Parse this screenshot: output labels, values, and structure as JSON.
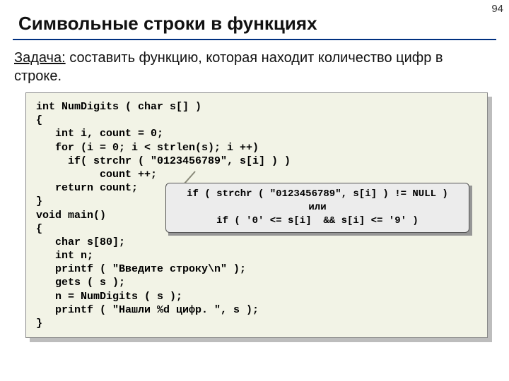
{
  "page_number": "94",
  "title": "Символьные строки в функциях",
  "task_label": "Задача:",
  "task_text": " составить функцию, которая находит количество цифр в строке.",
  "code": "int NumDigits ( char s[] )\n{\n   int i, count = 0;\n   for (i = 0; i < strlen(s); i ++)\n     if( strchr ( \"0123456789\", s[i] ) )\n          count ++;\n   return count;\n}\nvoid main()\n{\n   char s[80];\n   int n;\n   printf ( \"Введите строку\\n\" );\n   gets ( s );\n   n = NumDigits ( s );\n   printf ( \"Нашли %d цифр. \", s );\n}",
  "inset_line1": "if ( strchr ( \"0123456789\", s[i] ) != NULL )",
  "inset_line2": "или",
  "inset_line3": "if ( '0' <= s[i]  && s[i] <= '9' )"
}
